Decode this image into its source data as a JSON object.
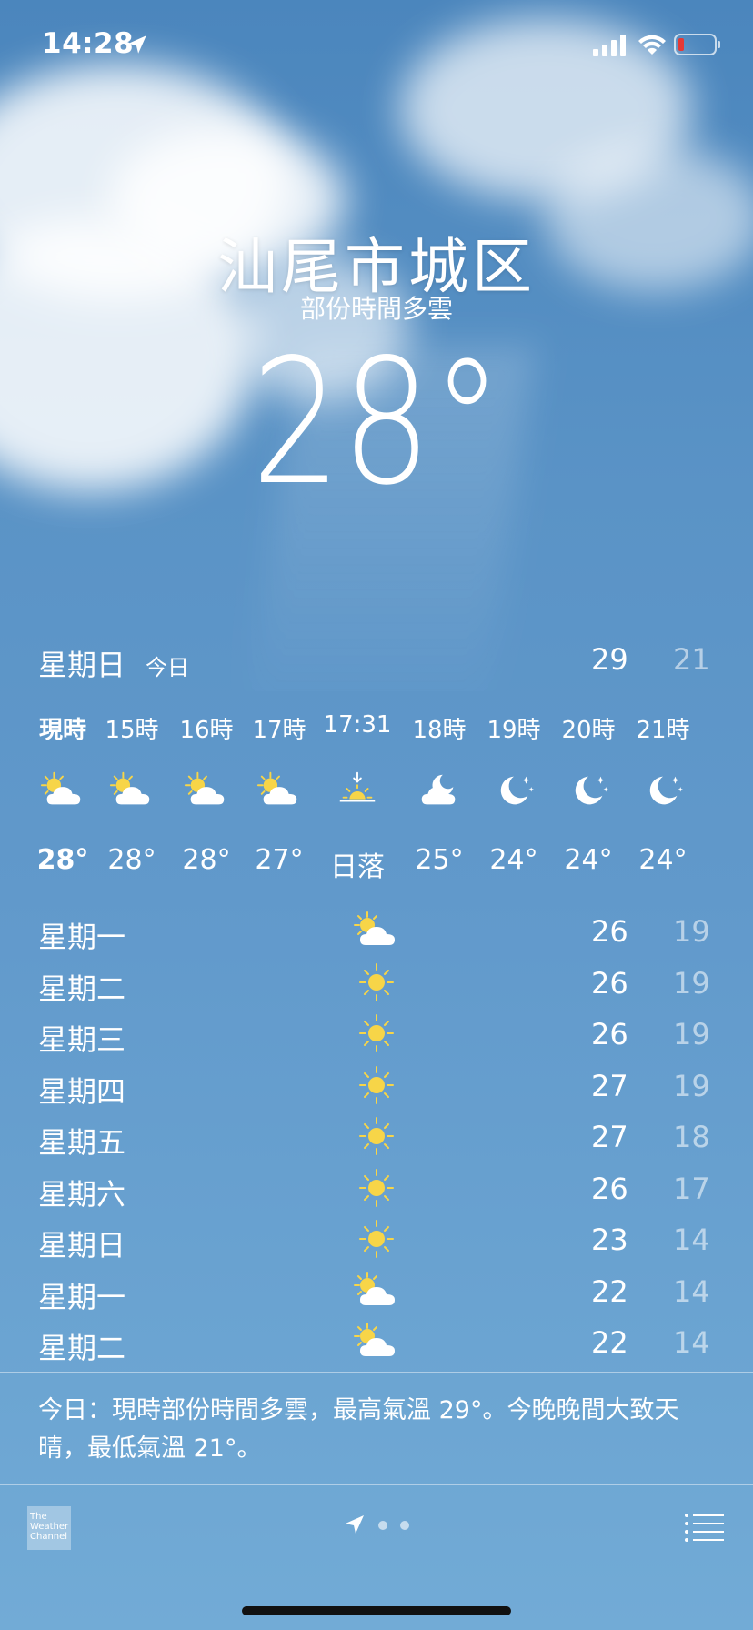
{
  "status_bar": {
    "time": "14:28"
  },
  "header": {
    "city": "汕尾市城区",
    "condition": "部份時間多雲",
    "temperature": "28°"
  },
  "today": {
    "day": "星期日",
    "label": "今日",
    "high": "29",
    "low": "21"
  },
  "hourly": [
    {
      "time": "現時",
      "icon": "partly-cloudy-icon",
      "temp": "28°"
    },
    {
      "time": "15時",
      "icon": "partly-cloudy-icon",
      "temp": "28°"
    },
    {
      "time": "16時",
      "icon": "partly-cloudy-icon",
      "temp": "28°"
    },
    {
      "time": "17時",
      "icon": "partly-cloudy-icon",
      "temp": "27°"
    },
    {
      "time": "17:31",
      "icon": "sunset-icon",
      "temp": "日落"
    },
    {
      "time": "18時",
      "icon": "partly-cloudy-night-icon",
      "temp": "25°"
    },
    {
      "time": "19時",
      "icon": "moon-icon",
      "temp": "24°"
    },
    {
      "time": "20時",
      "icon": "moon-icon",
      "temp": "24°"
    },
    {
      "time": "21時",
      "icon": "moon-icon",
      "temp": "24°"
    }
  ],
  "daily": [
    {
      "day": "星期一",
      "icon": "partly-cloudy-icon",
      "high": "26",
      "low": "19"
    },
    {
      "day": "星期二",
      "icon": "sun-icon",
      "high": "26",
      "low": "19"
    },
    {
      "day": "星期三",
      "icon": "sun-icon",
      "high": "26",
      "low": "19"
    },
    {
      "day": "星期四",
      "icon": "sun-icon",
      "high": "27",
      "low": "19"
    },
    {
      "day": "星期五",
      "icon": "sun-icon",
      "high": "27",
      "low": "18"
    },
    {
      "day": "星期六",
      "icon": "sun-icon",
      "high": "26",
      "low": "17"
    },
    {
      "day": "星期日",
      "icon": "sun-icon",
      "high": "23",
      "low": "14"
    },
    {
      "day": "星期一",
      "icon": "partly-cloudy-icon",
      "high": "22",
      "low": "14"
    },
    {
      "day": "星期二",
      "icon": "partly-cloudy-icon",
      "high": "22",
      "low": "14"
    }
  ],
  "summary": "今日：現時部份時間多雲，最高氣溫 29°。今晚晚間大致天晴，最低氣溫 21°。",
  "footer": {
    "logo_text": "The Weather Channel"
  },
  "colors": {
    "sun": "#f7d548",
    "battery_low": "#e53935"
  }
}
